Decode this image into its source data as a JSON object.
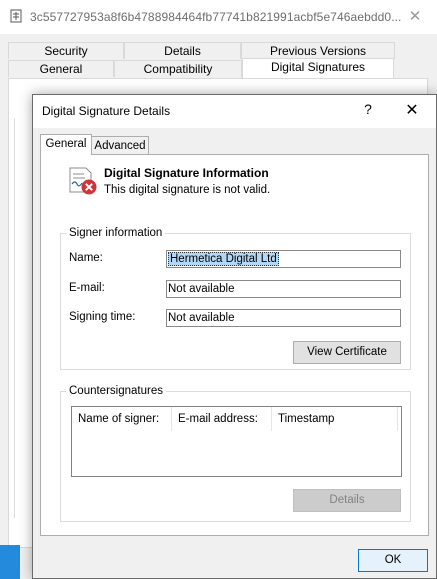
{
  "background_window": {
    "title": "3c557727953a8f6b4788984464fb77741b821991acbf5e746aebdd0...",
    "close_glyph": "✕",
    "tabs_row1": [
      "Security",
      "Details",
      "Previous Versions"
    ],
    "tabs_row2": [
      "General",
      "Compatibility",
      "Digital Signatures"
    ],
    "active_tab": "Digital Signatures"
  },
  "dialog": {
    "title": "Digital Signature Details",
    "help_glyph": "?",
    "close_glyph": "✕",
    "tabs": [
      "General",
      "Advanced"
    ],
    "active_tab": "General",
    "info": {
      "title": "Digital Signature Information",
      "status": "This digital signature is not valid."
    },
    "signer": {
      "legend": "Signer information",
      "name_label": "Name:",
      "name_value": "Hermetica Digital Ltd",
      "email_label": "E-mail:",
      "email_value": "Not available",
      "time_label": "Signing time:",
      "time_value": "Not available",
      "view_cert_label": "View Certificate"
    },
    "countersignatures": {
      "legend": "Countersignatures",
      "columns": [
        "Name of signer:",
        "E-mail address:",
        "Timestamp"
      ],
      "details_label": "Details"
    },
    "ok_label": "OK"
  },
  "colors": {
    "accent": "#0078d7",
    "error_red": "#d13438",
    "selection": "#b3d7f7"
  },
  "icons": [
    "file-icon",
    "certificate-error-icon",
    "close-icon",
    "help-icon"
  ]
}
